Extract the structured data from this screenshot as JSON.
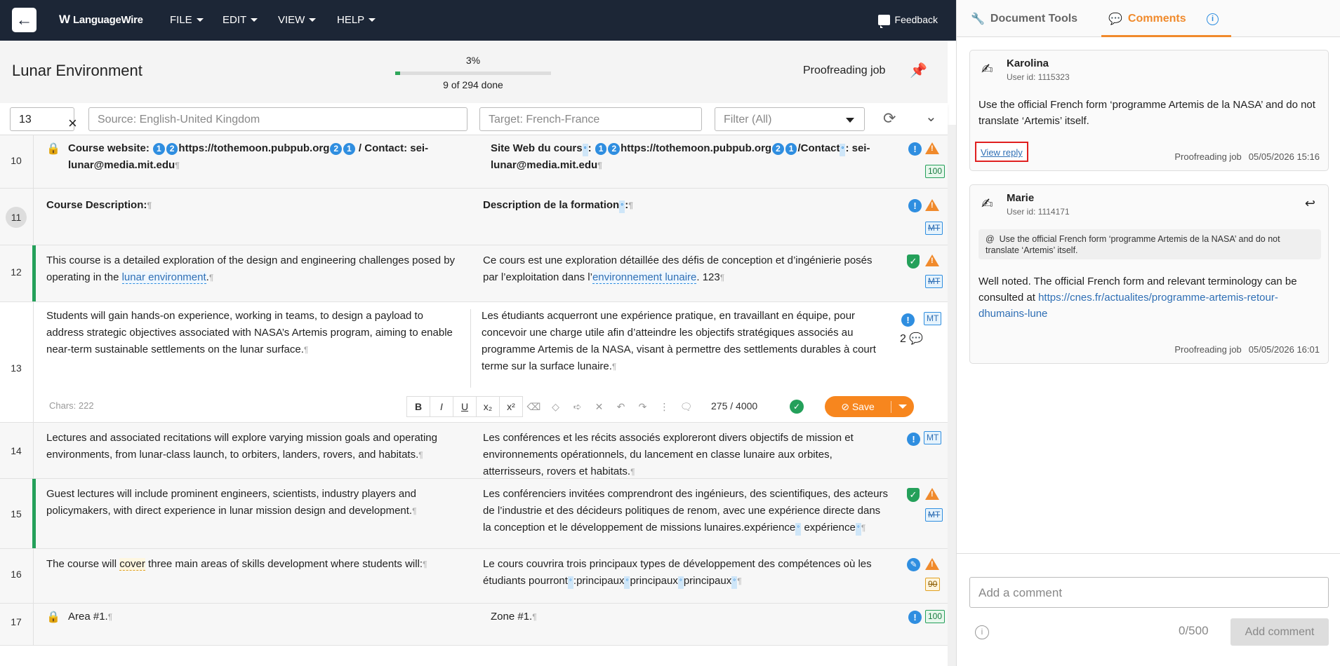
{
  "app": {
    "logo": "LanguageWire",
    "back_icon": "arrow-left-icon"
  },
  "menu": [
    {
      "label": "FILE"
    },
    {
      "label": "EDIT"
    },
    {
      "label": "VIEW"
    },
    {
      "label": "HELP"
    }
  ],
  "feedback_label": "Feedback",
  "document": {
    "title": "Lunar Environment",
    "progress_percent": "3%",
    "progress_value": 0.03,
    "progress_label": "9 of 294 done",
    "job_type": "Proofreading job"
  },
  "filters": {
    "segment_number": "13",
    "source_placeholder": "Source: English-United Kingdom",
    "target_placeholder": "Target: French-France",
    "filter_label": "Filter (All)"
  },
  "segments": [
    {
      "num": "10",
      "src_prefix": "Course website: ",
      "src_url": "https://tothemoon.pubpub.org",
      "src_suffix": " / Contact: sei-lunar@media.mit.edu",
      "tgt_prefix": "Site Web du cours",
      "tgt_url": "https://tothemoon.pubpub.org",
      "tgt_mid": "/Contact",
      "tgt_suffix": " sei-lunar@media.mit.edu",
      "badge": "100"
    },
    {
      "num": "11",
      "src": "Course Description:",
      "tgt": "Description de la formation",
      "badge": "MT"
    },
    {
      "num": "12",
      "src_a": "This course is a detailed exploration of the design and engineering challenges posed by operating in the ",
      "src_term": "lunar environment",
      "src_b": ".",
      "tgt_a": "Ce cours est une exploration détaillée des défis de conception et d’ingénierie posés par l’exploitation dans l’",
      "tgt_term": "environnement lunaire",
      "tgt_b": ". 123",
      "badge": "MT"
    },
    {
      "num": "13",
      "src": "Students will gain hands-on experience, working in teams, to design a payload to address strategic objectives associated with NASA’s Artemis program, aiming to enable near-term sustainable settlements on the lunar surface.",
      "tgt": "Les étudiants acquerront une expérience pratique, en travaillant en équipe, pour concevoir une charge utile afin d’atteindre les objectifs stratégiques associés au programme Artemis de la NASA, visant à permettre des settlements durables à court terme sur la surface lunaire.",
      "badge": "MT",
      "chars": "Chars: 222",
      "counter": "275 / 4000",
      "save": "Save",
      "comments": "2"
    },
    {
      "num": "14",
      "src": "Lectures and associated recitations will explore varying mission goals and operating environments, from lunar-class launch, to orbiters, landers, rovers, and habitats.",
      "tgt": "Les conférences et les récits associés exploreront divers objectifs de mission et environnements opérationnels, du lancement en classe lunaire aux orbites, atterrisseurs, rovers et habitats.",
      "badge": "MT"
    },
    {
      "num": "15",
      "src": "Guest lectures will include prominent engineers, scientists, industry players and policymakers, with direct experience in lunar mission design and development.",
      "tgt_a": "Les conférenciers invitées comprendront des ingénieurs, des scientifiques, des acteurs de l’industrie et des décideurs politiques de renom, avec une expérience directe dans la conception et le développement de missions lunaires.expérience",
      "tgt_b": "expérience",
      "badge": "MT"
    },
    {
      "num": "16",
      "src_a": "The course will ",
      "src_qa": "cover",
      "src_b": " three main areas of skills development where students will:",
      "tgt_a": "Le cours couvrira trois principaux types de développement des compétences où les étudiants pourront",
      "tgt_b": ":principaux",
      "tgt_c": "principaux",
      "tgt_d": "principaux",
      "badge": "90"
    },
    {
      "num": "17",
      "src": "Area #1.",
      "tgt": "Zone #1.",
      "badge": "100"
    }
  ],
  "panel": {
    "tab_tools": "Document Tools",
    "tab_comments": "Comments",
    "comments": [
      {
        "name": "Karolina",
        "user_id": "User id: 1115323",
        "text": "Use the official French form ‘programme Artemis de la NASA’ and do not translate ‘Artemis’ itself.",
        "view_reply": "View reply",
        "job": "Proofreading job",
        "date": "05/05/2026 15:16"
      },
      {
        "name": "Marie",
        "user_id": "User id: 1114171",
        "quote_mark": "@",
        "quote": "Use the official French form ‘programme Artemis de la NASA’ and do not translate ‘Artemis’ itself.",
        "text": "Well noted. The official French form and relevant terminology can be consulted at ",
        "link": "https://cnes.fr/actualites/programme-artemis-retour-dhumains-lune",
        "job": "Proofreading job",
        "date": "05/05/2026 16:01"
      }
    ],
    "composer_placeholder": "Add a comment",
    "composer_count": "0/500",
    "add_button": "Add comment"
  },
  "colors": {
    "topbar": "#1c2636",
    "accent": "#f08a2c",
    "link": "#2f6fb5",
    "success": "#24a05a"
  }
}
